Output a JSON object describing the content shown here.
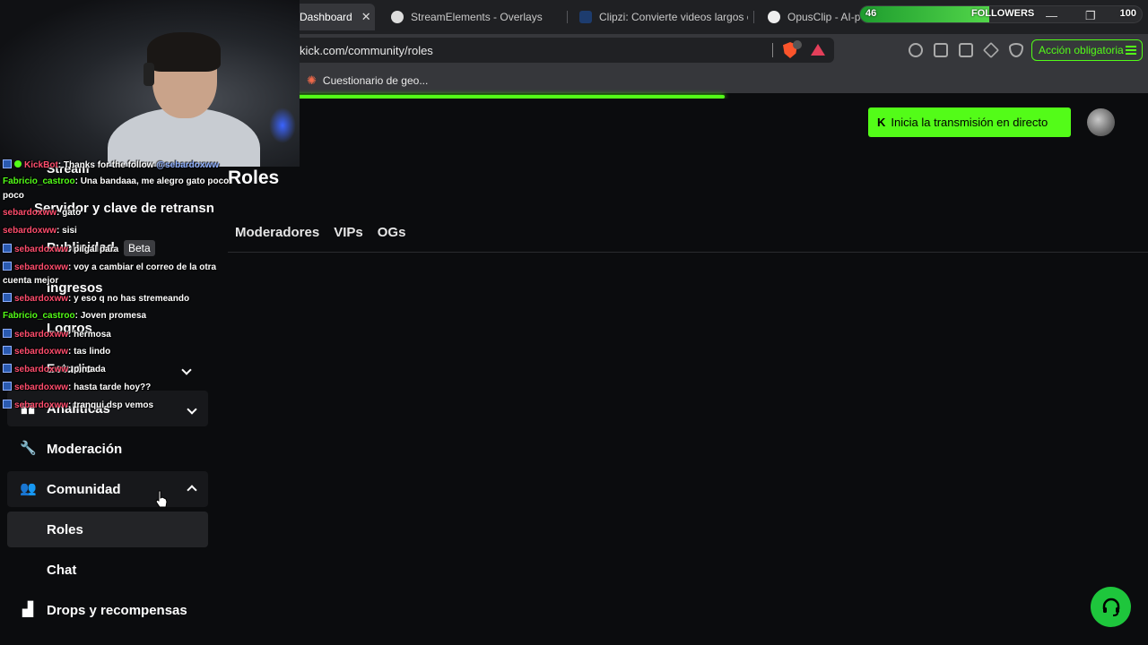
{
  "browser": {
    "tabs": [
      {
        "label": "Dashboard",
        "active": true
      },
      {
        "label": "StreamElements - Overlays"
      },
      {
        "label": "Clipzi: Convierte videos largos en"
      },
      {
        "label": "OpusClip - AI-po"
      }
    ],
    "url": "kick.com/community/roles",
    "bookmark": "Cuestionario de geo...",
    "action_button": "Acción obligatoria",
    "window_controls": {
      "minimize": "—",
      "maximize": "❐",
      "close": "✕"
    }
  },
  "followers_goal": {
    "label": "FOLLOWERS",
    "current": "46",
    "target": "100",
    "progress_fraction": 0.46
  },
  "page_load_progress_fraction": 0.64,
  "header": {
    "live_button": "Inicia la transmisión en directo",
    "live_icon": "K"
  },
  "main": {
    "title": "Roles",
    "tabs": [
      "Moderadores",
      "VIPs",
      "OGs"
    ]
  },
  "sidebar": {
    "partial_items": {
      "stream": "Stream",
      "server_key": "Servidor y clave de retransn",
      "publicidad": "Publicidad",
      "publicidad_badge": "Beta",
      "ingresos": "Ingresos",
      "logros": "Logros",
      "estudio": "Estudio"
    },
    "items": [
      {
        "label": "Analíticas",
        "icon": "chart-icon",
        "chevron": "down"
      },
      {
        "label": "Moderación",
        "icon": "wrench-icon"
      },
      {
        "label": "Comunidad",
        "icon": "community-icon",
        "chevron": "up"
      },
      {
        "label": "Roles",
        "selected": true
      },
      {
        "label": "Chat"
      },
      {
        "label": "Drops y recompensas",
        "icon": "drops-icon"
      }
    ]
  },
  "chat_overlay": [
    {
      "user": "KickBot",
      "text": ": Thanks for the follow ",
      "mention": "@sebardoxww",
      "color": "red",
      "verified": true,
      "badge": true
    },
    {
      "user": "Fabricio_castroo",
      "text": ": Una bandaaa, me alegro gato poco",
      "color": "green"
    },
    {
      "user": "",
      "text": "poco",
      "color": "none"
    },
    {
      "user": "sebardoxww",
      "text": ": gato",
      "color": "red"
    },
    {
      "user": "sebardoxww",
      "text": ": sisi",
      "color": "red"
    },
    {
      "user": "sebardoxww",
      "text": ": pilgal para",
      "color": "red",
      "badge": true
    },
    {
      "user": "sebardoxww",
      "text": ": voy a cambiar el correo de la otra",
      "color": "red",
      "badge": true
    },
    {
      "user": "",
      "text": "cuenta mejor",
      "color": "none"
    },
    {
      "user": "sebardoxww",
      "text": ": y eso q no has stremeando",
      "color": "red",
      "badge": true
    },
    {
      "user": "Fabricio_castroo",
      "text": ": Joven promesa",
      "color": "green"
    },
    {
      "user": "sebardoxww",
      "text": ": hermosa",
      "color": "red",
      "badge": true
    },
    {
      "user": "sebardoxww",
      "text": ": tas lindo",
      "color": "red",
      "badge": true
    },
    {
      "user": "sebardoxww",
      "text": ": pintada",
      "color": "red",
      "badge": true
    },
    {
      "user": "sebardoxww",
      "text": ": hasta tarde hoy??",
      "color": "red",
      "badge": true
    },
    {
      "user": "sebardoxww",
      "text": ": tranqui dsp vemos",
      "color": "red",
      "badge": true
    }
  ],
  "colors": {
    "accent": "#53fc18",
    "background": "#0b0c0e",
    "chat_red": "#ff4d6d"
  }
}
